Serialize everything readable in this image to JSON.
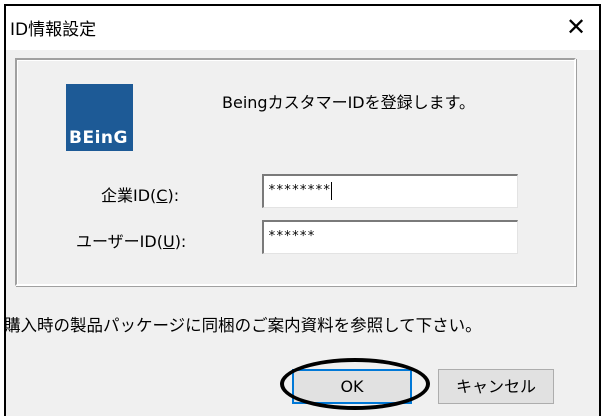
{
  "window": {
    "title": "ID情報設定",
    "close_glyph": "✕"
  },
  "logo": {
    "text": "BEinG",
    "brand_color": "#1d5a96"
  },
  "heading": "BeingカスタマーIDを登録します。",
  "fields": {
    "company_id": {
      "label_prefix": "企業ID(",
      "label_accel": "C",
      "label_suffix": "):",
      "value": "********"
    },
    "user_id": {
      "label_prefix": "ユーザーID(",
      "label_accel": "U",
      "label_suffix": "):",
      "value": "******"
    }
  },
  "note": "購入時の製品パッケージに同梱のご案内資料を参照して下さい。",
  "buttons": {
    "ok_label": "OK",
    "cancel_label": "キャンセル"
  }
}
